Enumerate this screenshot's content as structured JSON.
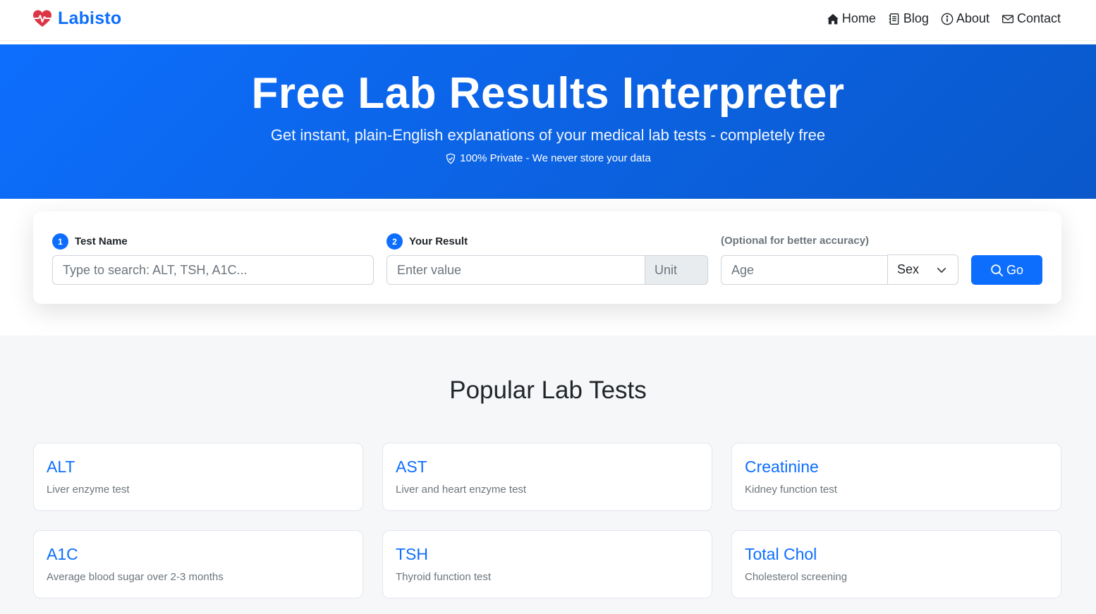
{
  "brand": {
    "name": "Labisto",
    "color": "#0d6efd",
    "icon": "heart-pulse-icon"
  },
  "nav": {
    "items": [
      {
        "label": "Home",
        "icon": "house-icon"
      },
      {
        "label": "Blog",
        "icon": "journal-icon"
      },
      {
        "label": "About",
        "icon": "info-circle-icon"
      },
      {
        "label": "Contact",
        "icon": "envelope-icon"
      }
    ]
  },
  "hero": {
    "title": "Free Lab Results Interpreter",
    "subtitle": "Get instant, plain-English explanations of your medical lab tests - completely free",
    "privacy": "100% Private - We never store your data"
  },
  "search": {
    "step1": {
      "num": "1",
      "label": "Test Name",
      "placeholder": "Type to search: ALT, TSH, A1C..."
    },
    "step2": {
      "num": "2",
      "label": "Your Result",
      "placeholder": "Enter value",
      "unit": "Unit"
    },
    "optional": {
      "label": "(Optional for better accuracy)",
      "age_placeholder": "Age",
      "sex_selected": "Sex"
    },
    "go_label": "Go"
  },
  "popular": {
    "title": "Popular Lab Tests",
    "tests": [
      {
        "name": "ALT",
        "desc": "Liver enzyme test"
      },
      {
        "name": "AST",
        "desc": "Liver and heart enzyme test"
      },
      {
        "name": "Creatinine",
        "desc": "Kidney function test"
      },
      {
        "name": "A1C",
        "desc": "Average blood sugar over 2-3 months"
      },
      {
        "name": "TSH",
        "desc": "Thyroid function test"
      },
      {
        "name": "Total Chol",
        "desc": "Cholesterol screening"
      }
    ]
  },
  "colors": {
    "primary": "#0d6efd",
    "heart": "#dc3545",
    "muted": "#6c757d"
  }
}
